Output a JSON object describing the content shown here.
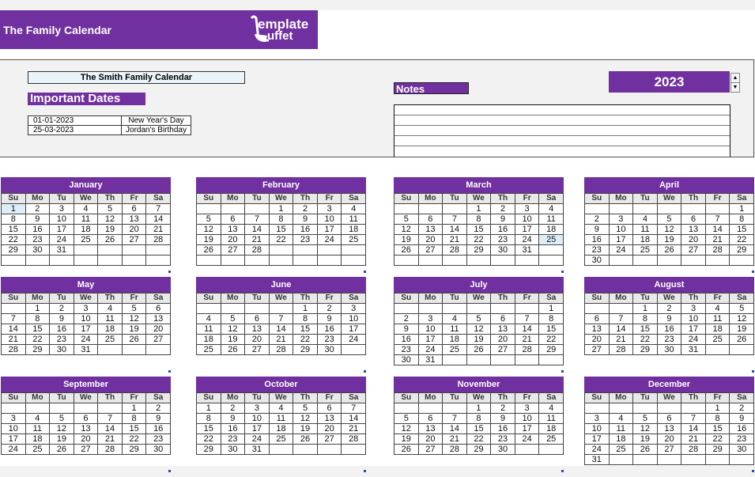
{
  "header": {
    "title": "The Family Calendar",
    "logo_line1": "emplate",
    "logo_line2": "uffet"
  },
  "panel": {
    "family_name": "The Smith Family Calendar",
    "important_dates_title": "Important Dates",
    "important_dates": [
      {
        "date": "01-01-2023",
        "name": "New Year's Day"
      },
      {
        "date": "25-03-2023",
        "name": "Jordan's Birthday"
      }
    ],
    "notes_label": "Notes",
    "notes_lines": [
      "",
      "",
      "",
      "",
      ""
    ],
    "year": "2023",
    "spinner_up": "▲",
    "spinner_down": "▼"
  },
  "weekdays": [
    "Su",
    "Mo",
    "Tu",
    "We",
    "Th",
    "Fr",
    "Sa"
  ],
  "highlight_color": "#ddeef9",
  "accent_color": "#7030a0",
  "months": [
    {
      "name": "January",
      "start": 0,
      "days": 31,
      "rows": 6,
      "highlight": [
        1
      ]
    },
    {
      "name": "February",
      "start": 3,
      "days": 28,
      "rows": 6,
      "highlight": []
    },
    {
      "name": "March",
      "start": 3,
      "days": 31,
      "rows": 6,
      "highlight": [
        25
      ]
    },
    {
      "name": "April",
      "start": 6,
      "days": 30,
      "rows": 6,
      "highlight": []
    },
    {
      "name": "May",
      "start": 1,
      "days": 31,
      "rows": 5,
      "highlight": []
    },
    {
      "name": "June",
      "start": 4,
      "days": 30,
      "rows": 5,
      "highlight": []
    },
    {
      "name": "July",
      "start": 6,
      "days": 31,
      "rows": 6,
      "highlight": []
    },
    {
      "name": "August",
      "start": 2,
      "days": 31,
      "rows": 5,
      "highlight": []
    },
    {
      "name": "September",
      "start": 5,
      "days": 30,
      "rows": 5,
      "highlight": []
    },
    {
      "name": "October",
      "start": 0,
      "days": 31,
      "rows": 5,
      "highlight": []
    },
    {
      "name": "November",
      "start": 3,
      "days": 30,
      "rows": 5,
      "highlight": []
    },
    {
      "name": "December",
      "start": 5,
      "days": 31,
      "rows": 6,
      "highlight": []
    }
  ]
}
